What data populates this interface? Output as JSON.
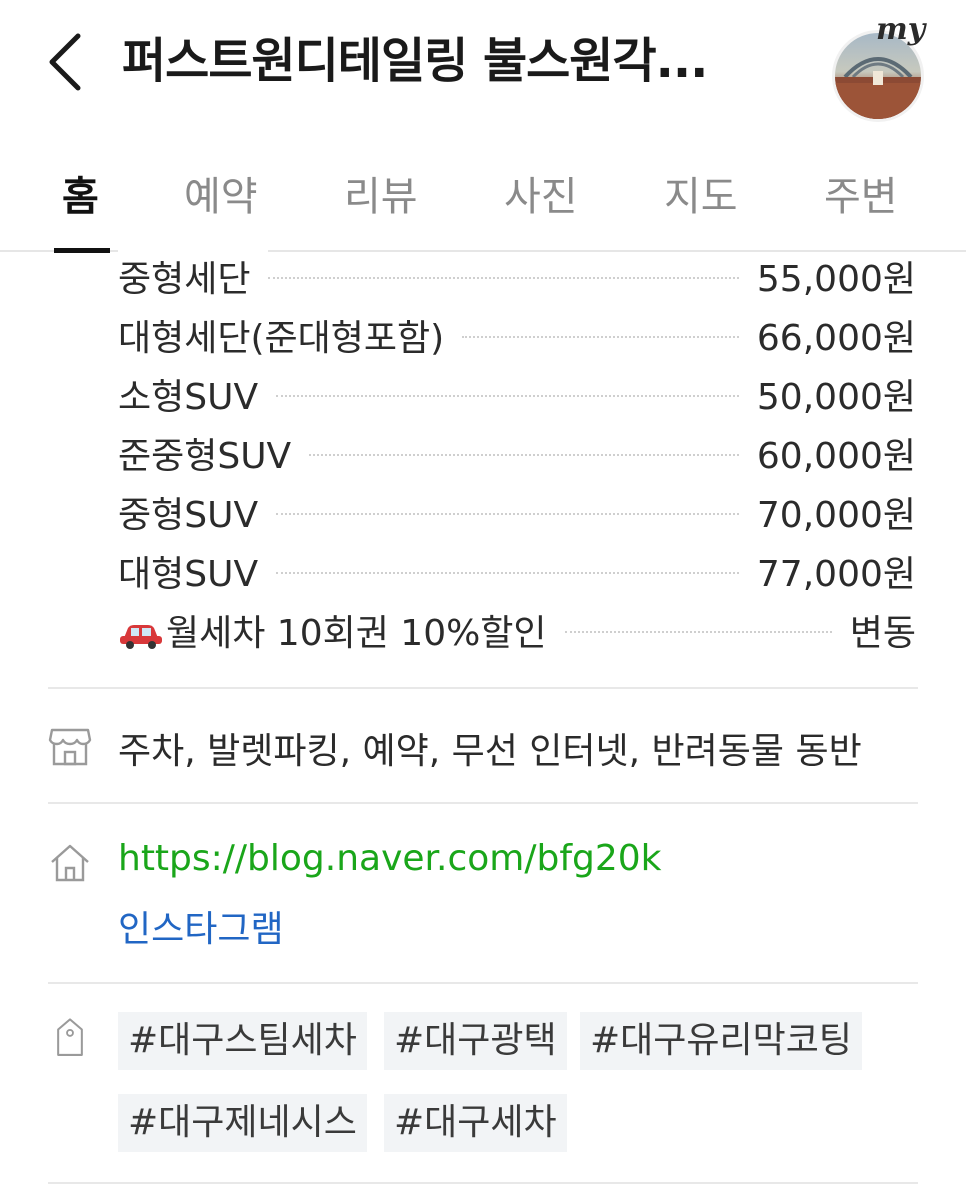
{
  "header": {
    "title": "퍼스트원디테일링 불스원각...",
    "my_label": "my"
  },
  "tabs": [
    {
      "label": "홈",
      "active": true
    },
    {
      "label": "예약",
      "active": false
    },
    {
      "label": "리뷰",
      "active": false
    },
    {
      "label": "사진",
      "active": false
    },
    {
      "label": "지도",
      "active": false
    },
    {
      "label": "주변",
      "active": false
    }
  ],
  "prices": [
    {
      "name": "중형세단",
      "value": "55,000원"
    },
    {
      "name": "대형세단(준대형포함)",
      "value": "66,000원"
    },
    {
      "name": "소형SUV",
      "value": "50,000원"
    },
    {
      "name": "준중형SUV",
      "value": "60,000원"
    },
    {
      "name": "중형SUV",
      "value": "70,000원"
    },
    {
      "name": "대형SUV",
      "value": "77,000원"
    },
    {
      "name": "월세차 10회권 10%할인",
      "value": "변동",
      "icon": "car-icon"
    }
  ],
  "amenities": "주차, 발렛파킹, 예약, 무선 인터넷, 반려동물 동반",
  "links": {
    "homepage": "https://blog.naver.com/bfg20k",
    "instagram": "인스타그램"
  },
  "tags": [
    "#대구스팀세차",
    "#대구광택",
    "#대구유리막코팅",
    "#대구제네시스",
    "#대구세차"
  ],
  "colors": {
    "link_green": "#1aa61a",
    "link_blue": "#2166c4",
    "tag_bg": "#f2f4f6"
  }
}
